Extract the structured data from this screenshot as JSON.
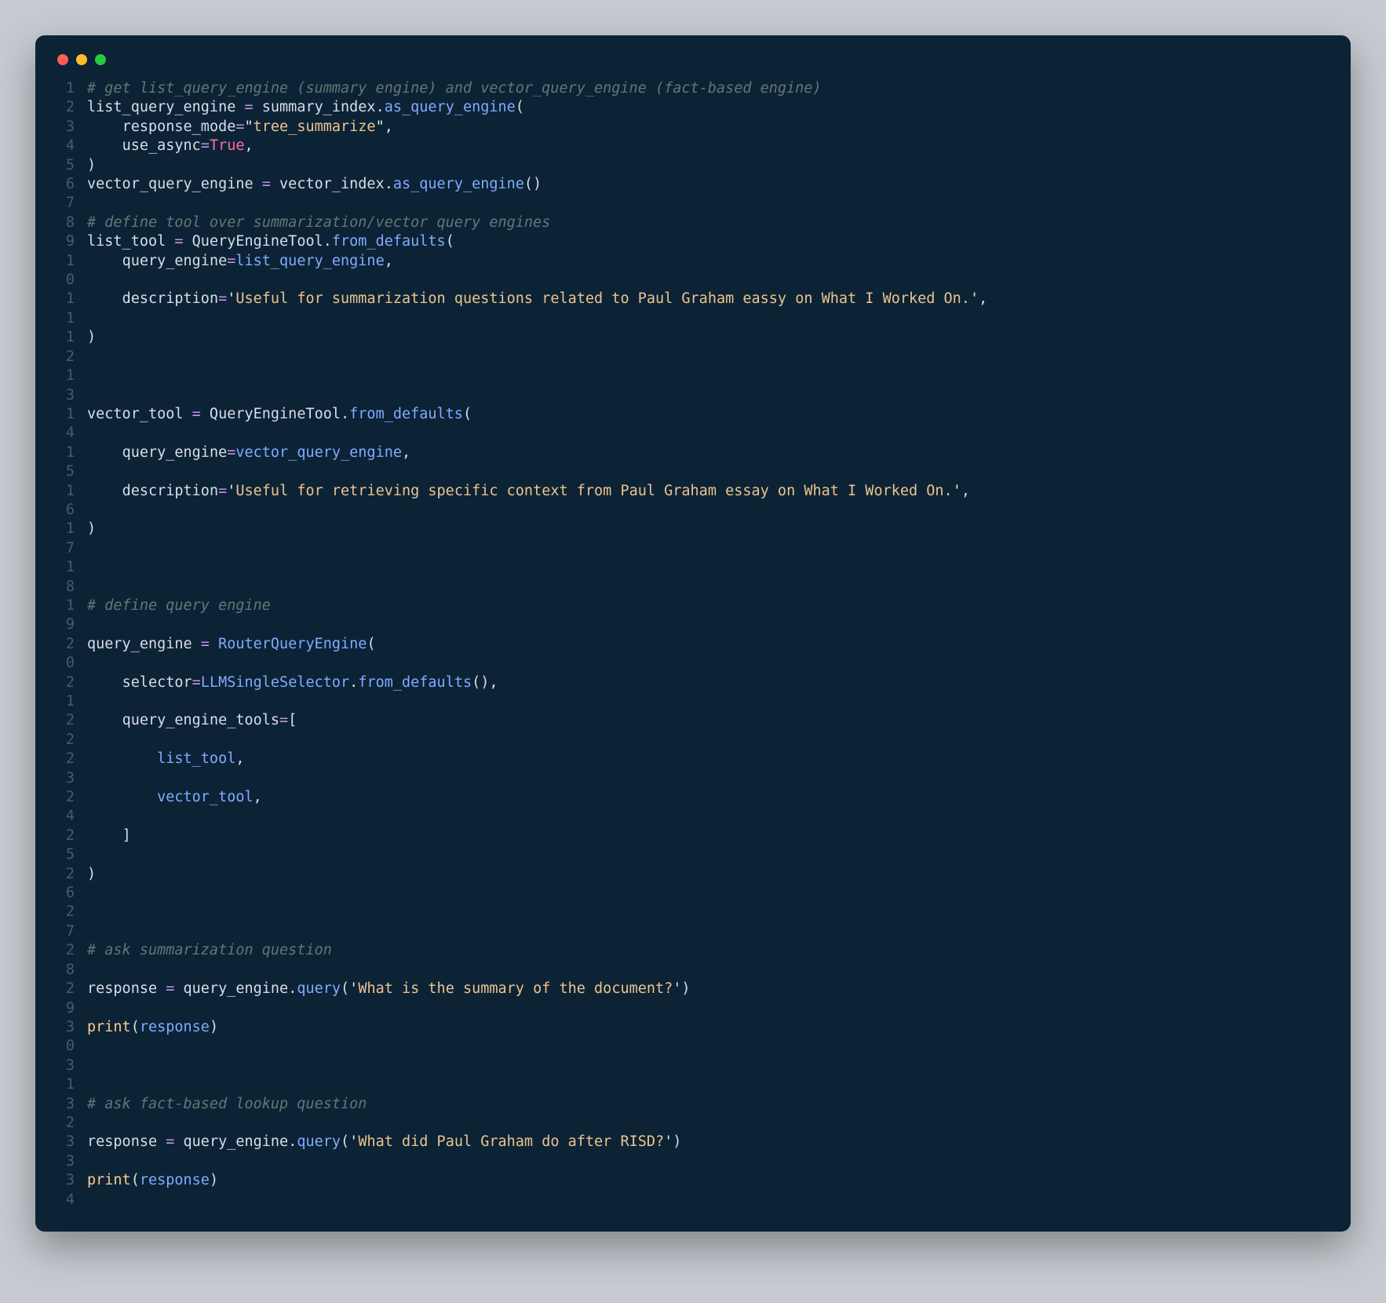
{
  "colors": {
    "bg": "#0c2336",
    "page": "#c7cbd1"
  },
  "traffic_lights": [
    "close",
    "minimize",
    "zoom"
  ],
  "lines": [
    {
      "n": "1",
      "seg": [
        {
          "t": "# get list_query_engine (summary engine) and vector_query_engine (fact-based engine)",
          "cls": "c"
        }
      ]
    },
    {
      "n": "2",
      "seg": [
        {
          "t": "list_query_engine ",
          "cls": "id"
        },
        {
          "t": "=",
          "cls": "op"
        },
        {
          "t": " summary_index",
          "cls": "id"
        },
        {
          "t": ".",
          "cls": "p"
        },
        {
          "t": "as_query_engine",
          "cls": "fn"
        },
        {
          "t": "(",
          "cls": "p"
        }
      ]
    },
    {
      "n": "3",
      "seg": [
        {
          "t": "    response_mode",
          "cls": "id"
        },
        {
          "t": "=",
          "cls": "op"
        },
        {
          "t": "\"",
          "cls": "sq"
        },
        {
          "t": "tree_summarize",
          "cls": "s"
        },
        {
          "t": "\"",
          "cls": "sq"
        },
        {
          "t": ",",
          "cls": "p"
        }
      ]
    },
    {
      "n": "4",
      "seg": [
        {
          "t": "    use_async",
          "cls": "id"
        },
        {
          "t": "=",
          "cls": "op"
        },
        {
          "t": "True",
          "cls": "kw"
        },
        {
          "t": ",",
          "cls": "p"
        }
      ]
    },
    {
      "n": "5",
      "seg": [
        {
          "t": ")",
          "cls": "p"
        }
      ]
    },
    {
      "n": "6",
      "seg": [
        {
          "t": "vector_query_engine ",
          "cls": "id"
        },
        {
          "t": "=",
          "cls": "op"
        },
        {
          "t": " vector_index",
          "cls": "id"
        },
        {
          "t": ".",
          "cls": "p"
        },
        {
          "t": "as_query_engine",
          "cls": "fn"
        },
        {
          "t": "()",
          "cls": "p"
        }
      ]
    },
    {
      "n": "7",
      "seg": [
        {
          "t": "",
          "cls": "id"
        }
      ]
    },
    {
      "n": "8",
      "seg": [
        {
          "t": "# define tool over summarization/vector query engines",
          "cls": "c"
        }
      ]
    },
    {
      "n": "9",
      "seg": [
        {
          "t": "list_tool ",
          "cls": "id"
        },
        {
          "t": "=",
          "cls": "op"
        },
        {
          "t": " QueryEngineTool",
          "cls": "id"
        },
        {
          "t": ".",
          "cls": "p"
        },
        {
          "t": "from_defaults",
          "cls": "fn"
        },
        {
          "t": "(",
          "cls": "p"
        }
      ]
    },
    {
      "n": "10",
      "seg": [
        {
          "t": "    query_engine",
          "cls": "id"
        },
        {
          "t": "=",
          "cls": "op"
        },
        {
          "t": "list_query_engine",
          "cls": "fn"
        },
        {
          "t": ",",
          "cls": "p"
        }
      ]
    },
    {
      "n": "11",
      "seg": [
        {
          "t": "    description",
          "cls": "id"
        },
        {
          "t": "=",
          "cls": "op"
        },
        {
          "t": "'",
          "cls": "sq"
        },
        {
          "t": "Useful for summarization questions related to Paul Graham eassy on What I Worked On.",
          "cls": "s"
        },
        {
          "t": "'",
          "cls": "sq"
        },
        {
          "t": ",",
          "cls": "p"
        }
      ]
    },
    {
      "n": "12",
      "seg": [
        {
          "t": ")",
          "cls": "p"
        }
      ]
    },
    {
      "n": "13",
      "seg": [
        {
          "t": "",
          "cls": "id"
        }
      ]
    },
    {
      "n": "14",
      "seg": [
        {
          "t": "vector_tool ",
          "cls": "id"
        },
        {
          "t": "=",
          "cls": "op"
        },
        {
          "t": " QueryEngineTool",
          "cls": "id"
        },
        {
          "t": ".",
          "cls": "p"
        },
        {
          "t": "from_defaults",
          "cls": "fn"
        },
        {
          "t": "(",
          "cls": "p"
        }
      ]
    },
    {
      "n": "15",
      "seg": [
        {
          "t": "    query_engine",
          "cls": "id"
        },
        {
          "t": "=",
          "cls": "op"
        },
        {
          "t": "vector_query_engine",
          "cls": "fn"
        },
        {
          "t": ",",
          "cls": "p"
        }
      ]
    },
    {
      "n": "16",
      "seg": [
        {
          "t": "    description",
          "cls": "id"
        },
        {
          "t": "=",
          "cls": "op"
        },
        {
          "t": "'",
          "cls": "sq"
        },
        {
          "t": "Useful for retrieving specific context from Paul Graham essay on What I Worked On.",
          "cls": "s"
        },
        {
          "t": "'",
          "cls": "sq"
        },
        {
          "t": ",",
          "cls": "p"
        }
      ]
    },
    {
      "n": "17",
      "seg": [
        {
          "t": ")",
          "cls": "p"
        }
      ]
    },
    {
      "n": "18",
      "seg": [
        {
          "t": "",
          "cls": "id"
        }
      ]
    },
    {
      "n": "19",
      "seg": [
        {
          "t": "# define query engine",
          "cls": "c"
        }
      ]
    },
    {
      "n": "20",
      "seg": [
        {
          "t": "query_engine ",
          "cls": "id"
        },
        {
          "t": "=",
          "cls": "op"
        },
        {
          "t": " ",
          "cls": "id"
        },
        {
          "t": "RouterQueryEngine",
          "cls": "fn"
        },
        {
          "t": "(",
          "cls": "p"
        }
      ]
    },
    {
      "n": "21",
      "seg": [
        {
          "t": "    selector",
          "cls": "id"
        },
        {
          "t": "=",
          "cls": "op"
        },
        {
          "t": "LLMSingleSelector",
          "cls": "fn"
        },
        {
          "t": ".",
          "cls": "p"
        },
        {
          "t": "from_defaults",
          "cls": "fn"
        },
        {
          "t": "(),",
          "cls": "p"
        }
      ]
    },
    {
      "n": "22",
      "seg": [
        {
          "t": "    query_engine_tools",
          "cls": "id"
        },
        {
          "t": "=",
          "cls": "op"
        },
        {
          "t": "[",
          "cls": "p"
        }
      ]
    },
    {
      "n": "23",
      "seg": [
        {
          "t": "        ",
          "cls": "id"
        },
        {
          "t": "list_tool",
          "cls": "fn"
        },
        {
          "t": ",",
          "cls": "p"
        }
      ]
    },
    {
      "n": "24",
      "seg": [
        {
          "t": "        ",
          "cls": "id"
        },
        {
          "t": "vector_tool",
          "cls": "fn"
        },
        {
          "t": ",",
          "cls": "p"
        }
      ]
    },
    {
      "n": "25",
      "seg": [
        {
          "t": "    ]",
          "cls": "p"
        }
      ]
    },
    {
      "n": "26",
      "seg": [
        {
          "t": ")",
          "cls": "p"
        }
      ]
    },
    {
      "n": "27",
      "seg": [
        {
          "t": "",
          "cls": "id"
        }
      ]
    },
    {
      "n": "28",
      "seg": [
        {
          "t": "# ask summarization question",
          "cls": "c"
        }
      ]
    },
    {
      "n": "29",
      "seg": [
        {
          "t": "response ",
          "cls": "id"
        },
        {
          "t": "=",
          "cls": "op"
        },
        {
          "t": " query_engine",
          "cls": "id"
        },
        {
          "t": ".",
          "cls": "p"
        },
        {
          "t": "query",
          "cls": "fn"
        },
        {
          "t": "(",
          "cls": "p"
        },
        {
          "t": "'",
          "cls": "sq"
        },
        {
          "t": "What is the summary of the document?",
          "cls": "s"
        },
        {
          "t": "'",
          "cls": "sq"
        },
        {
          "t": ")",
          "cls": "p"
        }
      ]
    },
    {
      "n": "30",
      "seg": [
        {
          "t": "print",
          "cls": "cl"
        },
        {
          "t": "(",
          "cls": "p"
        },
        {
          "t": "response",
          "cls": "fn"
        },
        {
          "t": ")",
          "cls": "p"
        }
      ]
    },
    {
      "n": "31",
      "seg": [
        {
          "t": "",
          "cls": "id"
        }
      ]
    },
    {
      "n": "32",
      "seg": [
        {
          "t": "# ask fact-based lookup question",
          "cls": "c"
        }
      ]
    },
    {
      "n": "33",
      "seg": [
        {
          "t": "response ",
          "cls": "id"
        },
        {
          "t": "=",
          "cls": "op"
        },
        {
          "t": " query_engine",
          "cls": "id"
        },
        {
          "t": ".",
          "cls": "p"
        },
        {
          "t": "query",
          "cls": "fn"
        },
        {
          "t": "(",
          "cls": "p"
        },
        {
          "t": "'",
          "cls": "sq"
        },
        {
          "t": "What did Paul Graham do after RISD?",
          "cls": "s"
        },
        {
          "t": "'",
          "cls": "sq"
        },
        {
          "t": ")",
          "cls": "p"
        }
      ]
    },
    {
      "n": "34",
      "seg": [
        {
          "t": "print",
          "cls": "cl"
        },
        {
          "t": "(",
          "cls": "p"
        },
        {
          "t": "response",
          "cls": "fn"
        },
        {
          "t": ")",
          "cls": "p"
        }
      ]
    }
  ]
}
